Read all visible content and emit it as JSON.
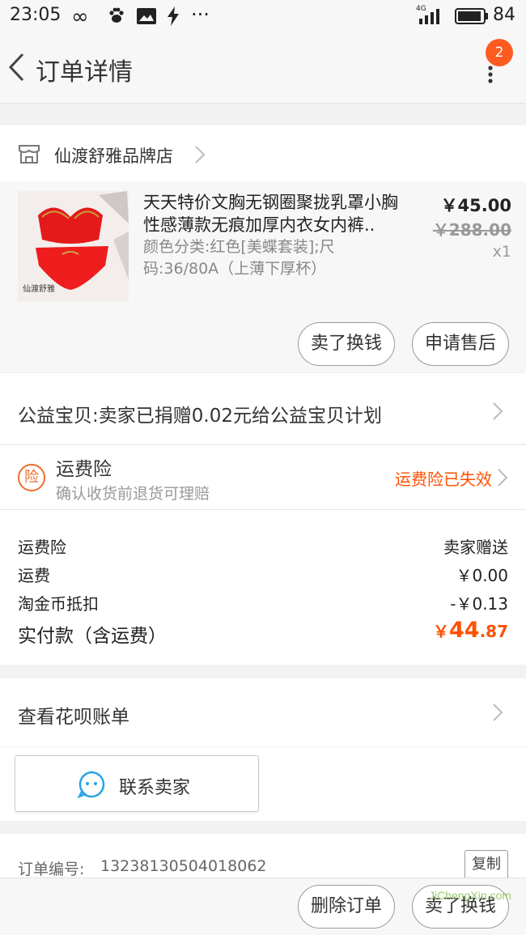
{
  "status_bar": {
    "time": "23:05",
    "network": "4G",
    "battery": "84"
  },
  "nav": {
    "title": "订单详情",
    "badge_count": "2"
  },
  "shop": {
    "name": "仙渡舒雅品牌店"
  },
  "item": {
    "title": "天天特价文胸无钢圈聚拢乳罩小胸性感薄款无痕加厚内衣女内裤..",
    "spec": "颜色分类:红色[美蝶套装];尺码:36/80A（上薄下厚杯）",
    "price": "￥45.00",
    "original_price": "￥288.00",
    "quantity": "x1",
    "thumb_brand": "仙渡舒雅"
  },
  "item_actions": {
    "sell_label": "卖了换钱",
    "aftersale_label": "申请售后"
  },
  "charity": {
    "text": "公益宝贝:卖家已捐赠0.02元给公益宝贝计划"
  },
  "insurance": {
    "icon_char": "险",
    "title": "运费险",
    "subtitle": "确认收货前退货可理赔",
    "status": "运费险已失效"
  },
  "fees": {
    "rows": [
      {
        "label": "运费险",
        "value": "卖家赠送"
      },
      {
        "label": "运费",
        "value": "￥0.00"
      },
      {
        "label": "淘金币抵扣",
        "value": "-￥0.13"
      }
    ],
    "total_label": "实付款（含运费）",
    "total_currency": "￥",
    "total_int": "44",
    "total_dec": ".87"
  },
  "huabei": {
    "text": "查看花呗账单"
  },
  "contact": {
    "label": "联系卖家"
  },
  "order": {
    "number_label": "订单编号:",
    "number": "13238130504018062",
    "copy_label": "复制"
  },
  "bottom": {
    "delete_label": "删除订单",
    "sell_label": "卖了换钱"
  },
  "watermark": {
    "text": "JiChengXin.com"
  },
  "colors": {
    "accent": "#ff5000",
    "badge": "#ff5a1f",
    "background": "#f2f2f2"
  }
}
